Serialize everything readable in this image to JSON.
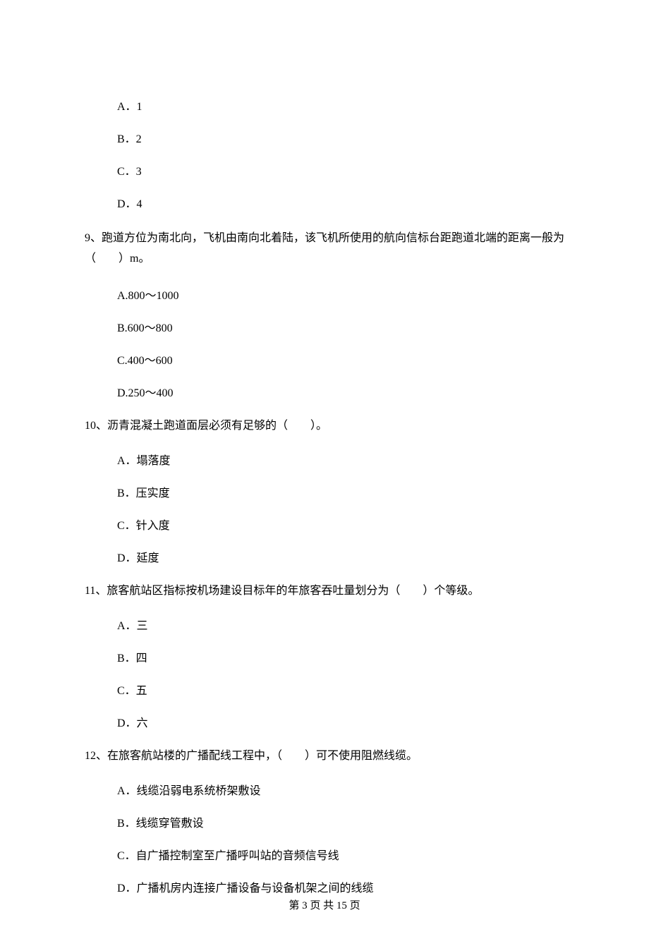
{
  "q8": {
    "options": {
      "a": "A．1",
      "b": "B．2",
      "c": "C．3",
      "d": "D．4"
    }
  },
  "q9": {
    "text": "9、跑道方位为南北向，飞机由南向北着陆，该飞机所使用的航向信标台距跑道北端的距离一般为（　　）m。",
    "options": {
      "a": "A.800～1000",
      "b": "B.600～800",
      "c": "C.400～600",
      "d": "D.250～400"
    }
  },
  "q10": {
    "text": "10、沥青混凝土跑道面层必须有足够的（　　）。",
    "options": {
      "a": "A．塌落度",
      "b": "B．压实度",
      "c": "C．针入度",
      "d": "D．延度"
    }
  },
  "q11": {
    "text": "11、旅客航站区指标按机场建设目标年的年旅客吞吐量划分为（　　）个等级。",
    "options": {
      "a": "A．三",
      "b": "B．四",
      "c": "C．五",
      "d": "D．六"
    }
  },
  "q12": {
    "text": "12、在旅客航站楼的广播配线工程中，（　　）可不使用阻燃线缆。",
    "options": {
      "a": "A．线缆沿弱电系统桥架敷设",
      "b": "B．线缆穿管敷设",
      "c": "C．自广播控制室至广播呼叫站的音频信号线",
      "d": "D．广播机房内连接广播设备与设备机架之间的线缆"
    }
  },
  "footer": "第 3 页 共 15 页"
}
